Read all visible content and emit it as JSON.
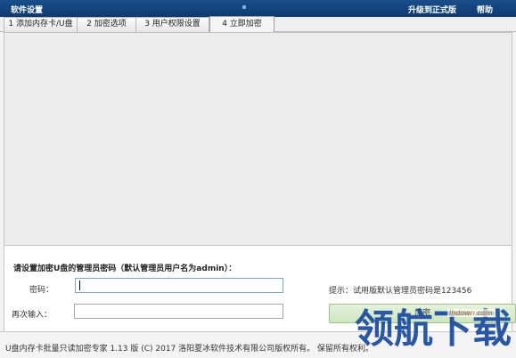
{
  "titlebar": {
    "title": "软件设置",
    "upgrade": "升级到正式版",
    "help": "帮助"
  },
  "tabs": [
    {
      "label": "1 添加内存卡/U盘"
    },
    {
      "label": "2 加密选项"
    },
    {
      "label": "3 用户权限设置"
    },
    {
      "label": "4 立即加密"
    }
  ],
  "active_tab_index": 3,
  "form": {
    "prompt": "请设置加密U盘的管理员密码（默认管理员用户名为admin）：",
    "password_label": "密码：",
    "password_value": "",
    "confirm_label": "再次输入：",
    "confirm_value": "",
    "hint": "提示：试用版默认管理员密码是123456",
    "encrypt_button": "加密"
  },
  "status": {
    "text": "U盘内存卡批量只读加密专家 1.13 版 (C) 2017 洛阳夏冰软件技术有限公司版权所有。 保留所有权利。"
  },
  "watermark": {
    "text": "领航下载",
    "url": "lhdown.com"
  },
  "colors": {
    "titlebar": "#0c3a70",
    "button": "#cde6bd",
    "watermark": "#1e4fa3"
  }
}
